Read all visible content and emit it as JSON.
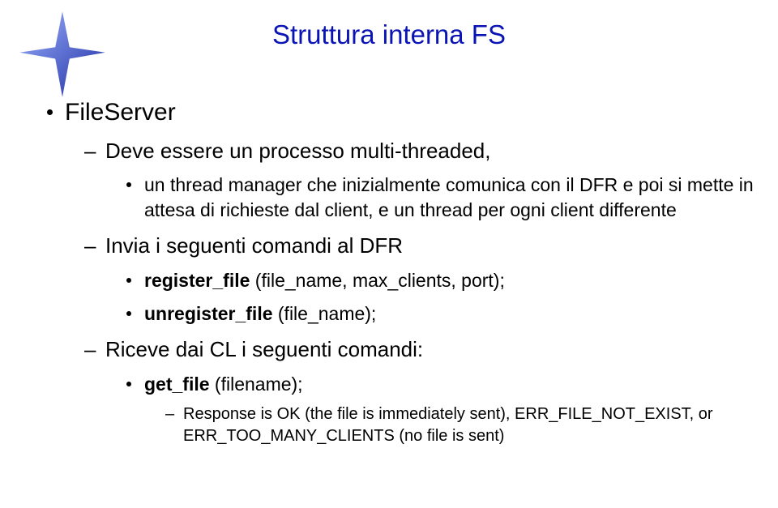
{
  "title": "Struttura interna FS",
  "bullets": {
    "l1": "FileServer",
    "l2a": "Deve essere un processo multi-threaded,",
    "l2a_sub1": "un thread manager che inizialmente comunica con il DFR e poi si mette in attesa di richieste dal client, e un thread per ogni client differente",
    "l2b": "Invia i seguenti comandi al DFR",
    "l2b_sub1_bold": "register_file",
    "l2b_sub1_rest": " (file_name, max_clients, port);",
    "l2b_sub2_bold": "unregister_file",
    "l2b_sub2_rest": " (file_name);",
    "l2c": "Riceve dai CL i seguenti comandi:",
    "l2c_sub1_bold": "get_file",
    "l2c_sub1_rest": " (filename);",
    "l2c_sub1_resp": "Response is OK (the file is immediately sent), ERR_FILE_NOT_EXIST, or ERR_TOO_MANY_CLIENTS (no file is sent)"
  }
}
